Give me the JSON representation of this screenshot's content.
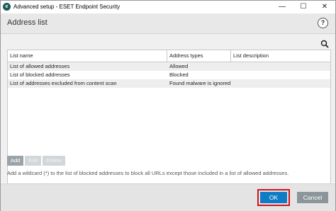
{
  "window": {
    "title": "Advanced setup - ESET Endpoint Security",
    "app_icon_letter": "e",
    "minimize_glyph": "—",
    "maximize_glyph": "☐",
    "close_glyph": "✕"
  },
  "header": {
    "title": "Address list",
    "help_glyph": "?"
  },
  "table": {
    "columns": [
      "List name",
      "Address types",
      "List description"
    ],
    "rows": [
      {
        "name": "List of allowed addresses",
        "type": "Allowed",
        "description": ""
      },
      {
        "name": "List of blocked addresses",
        "type": "Blocked",
        "description": ""
      },
      {
        "name": "List of addresses excluded from content scan",
        "type": "Found malware is ignored",
        "description": ""
      }
    ]
  },
  "actions": {
    "add_label": "Add",
    "edit_label": "Edit",
    "delete_label": "Delete"
  },
  "hint": "Add a wildcard (*) to the list of blocked addresses to block all URLs except those included in a list of allowed addresses.",
  "footer": {
    "ok_label": "OK",
    "cancel_label": "Cancel"
  },
  "colors": {
    "ok_button": "#0f7cc6",
    "highlight": "#d0141c",
    "cancel_button": "#8b959a"
  },
  "icons": {
    "search": "search-icon",
    "help": "help-icon",
    "app": "eset-logo-icon"
  }
}
